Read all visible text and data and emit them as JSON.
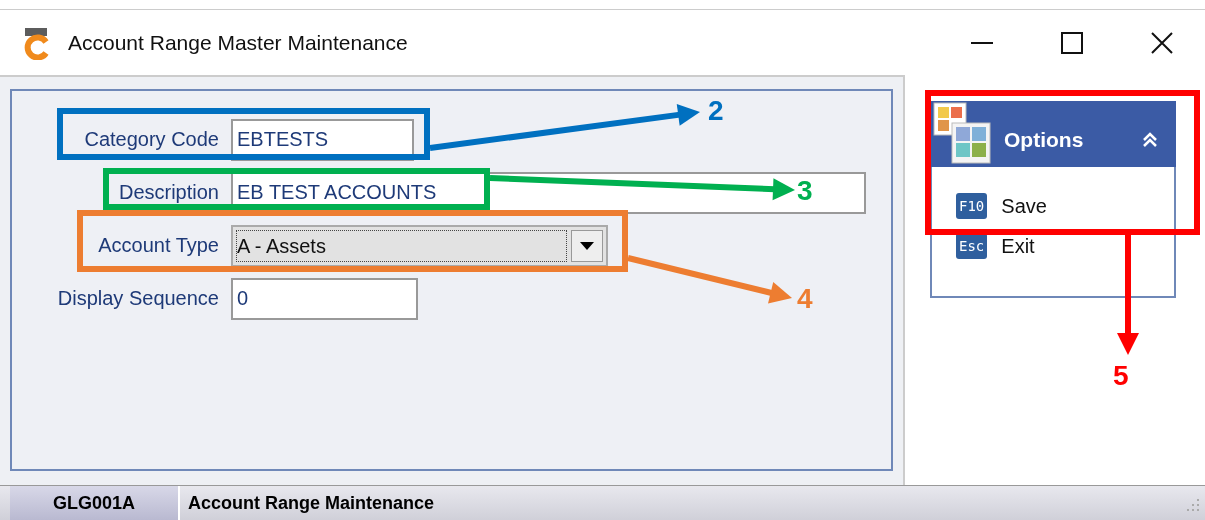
{
  "window": {
    "title": "Account Range Master Maintenance"
  },
  "form": {
    "fields": [
      {
        "kind": "text",
        "label": "Category Code",
        "value": "EBTESTS"
      },
      {
        "kind": "text",
        "label": "Description",
        "value": "EB TEST ACCOUNTS"
      },
      {
        "kind": "combo",
        "label": "Account Type",
        "value": "A - Assets"
      },
      {
        "kind": "text",
        "label": "Display Sequence",
        "value": "0"
      }
    ]
  },
  "options": {
    "title": "Options",
    "items": [
      {
        "key": "F10",
        "label": "Save"
      },
      {
        "key": "Esc",
        "label": "Exit"
      }
    ]
  },
  "status_bar": {
    "code": "GLG001A",
    "text": "Account Range Maintenance"
  },
  "annotations": [
    {
      "number": "2",
      "color": "#0070c0"
    },
    {
      "number": "3",
      "color": "#00b050"
    },
    {
      "number": "4",
      "color": "#ed7d31"
    },
    {
      "number": "5",
      "color": "#ff0000"
    }
  ]
}
